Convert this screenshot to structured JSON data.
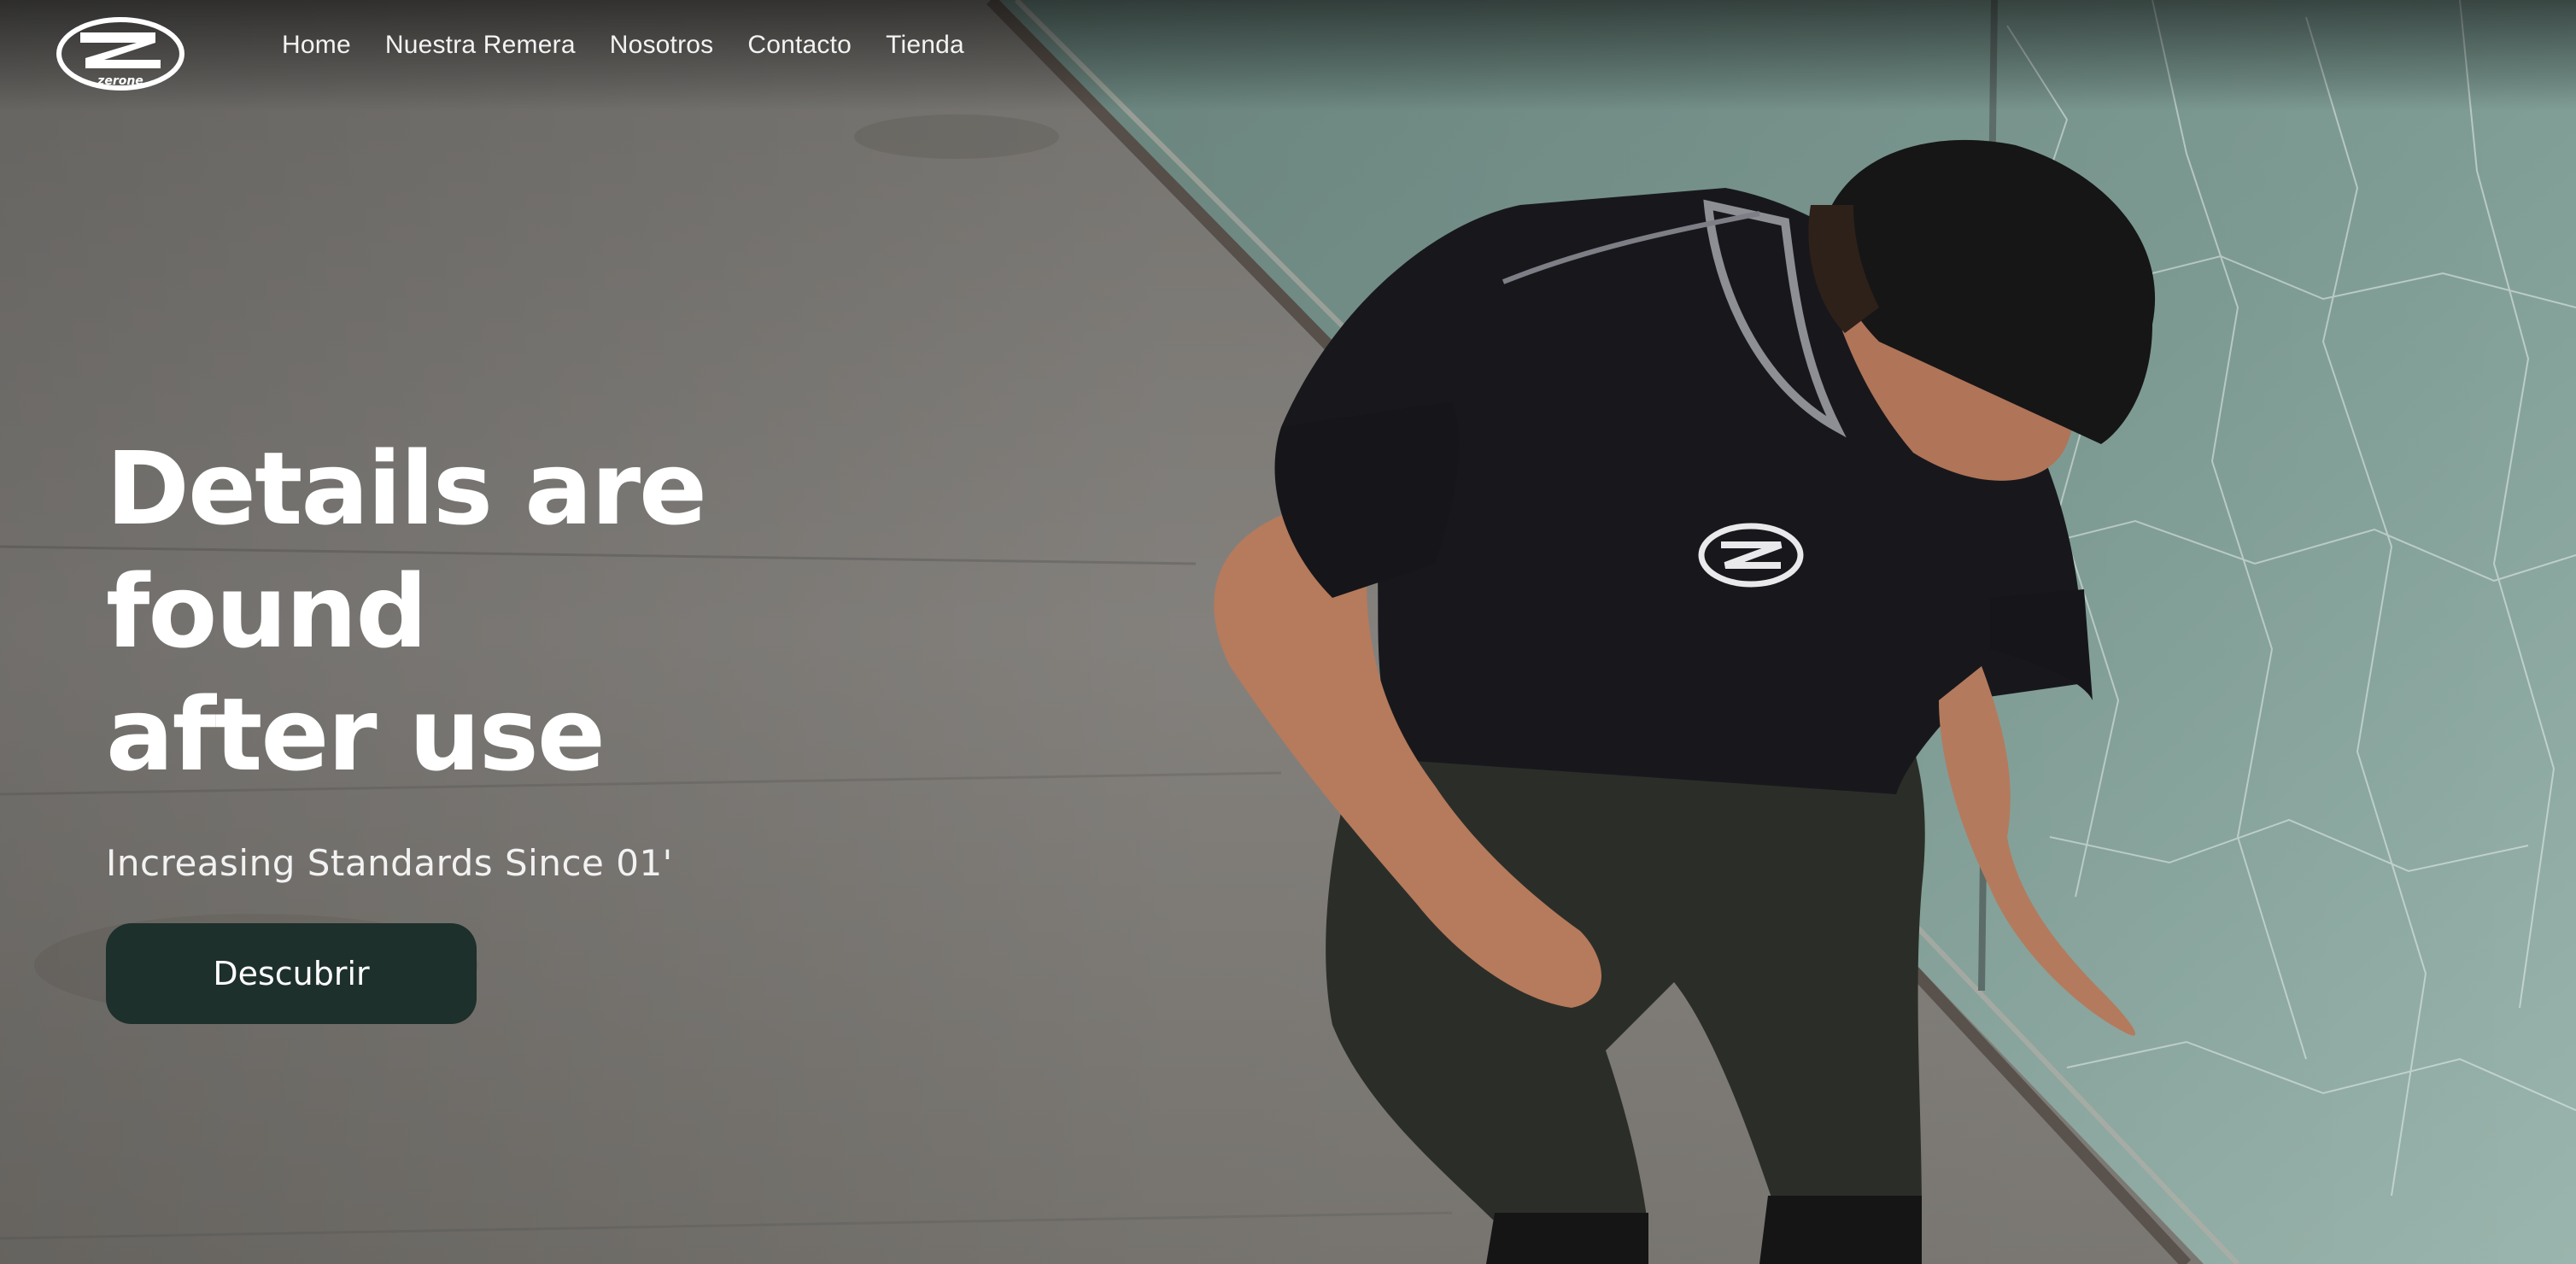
{
  "brand": {
    "logo_text": "zerone"
  },
  "nav": {
    "items": [
      {
        "label": "Home"
      },
      {
        "label": "Nuestra Remera"
      },
      {
        "label": "Nosotros"
      },
      {
        "label": "Contacto"
      },
      {
        "label": "Tienda"
      }
    ]
  },
  "hero": {
    "title_line1": "Details are found",
    "title_line2": "after use",
    "subtitle": "Increasing Standards Since 01'",
    "cta_label": "Descubrir"
  },
  "colors": {
    "cta_background": "#1d302b",
    "text": "#ffffff"
  }
}
